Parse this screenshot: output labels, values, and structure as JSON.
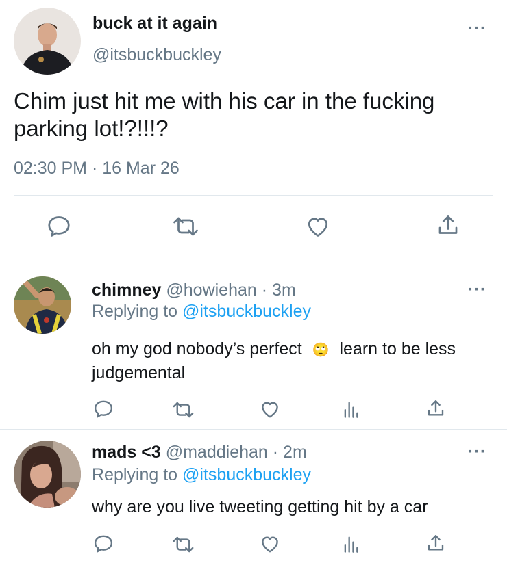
{
  "main_tweet": {
    "display_name": "buck at it again",
    "handle": "@itsbuckbuckley",
    "text": "Chim just hit me with his car in the fucking parking lot!?!!!?",
    "timestamp": "02:30 PM · 16 Mar 26",
    "more": "···",
    "actions": [
      "reply-icon",
      "retweet-icon",
      "like-icon",
      "share-icon"
    ]
  },
  "replies": [
    {
      "display_name": "chimney",
      "handle": "@howiehan",
      "time": "· 3m",
      "replying_label": "Replying to",
      "replying_to": "@itsbuckbuckley",
      "text_before": "oh my god nobody’s perfect",
      "emoji": "🙄",
      "text_after": "learn to be less judgemental",
      "more": "···",
      "actions": [
        "reply-icon",
        "retweet-icon",
        "like-icon",
        "analytics-icon",
        "share-icon"
      ]
    },
    {
      "display_name": "mads <3",
      "handle": "@maddiehan",
      "time": "· 2m",
      "replying_label": "Replying to",
      "replying_to": "@itsbuckbuckley",
      "text": "why are you live tweeting getting hit by a car",
      "more": "···",
      "actions": [
        "reply-icon",
        "retweet-icon",
        "like-icon",
        "analytics-icon",
        "share-icon"
      ]
    }
  ],
  "colors": {
    "text": "#14171a",
    "secondary": "#657786",
    "link": "#1da1f2",
    "divider": "#e1e8ed"
  }
}
